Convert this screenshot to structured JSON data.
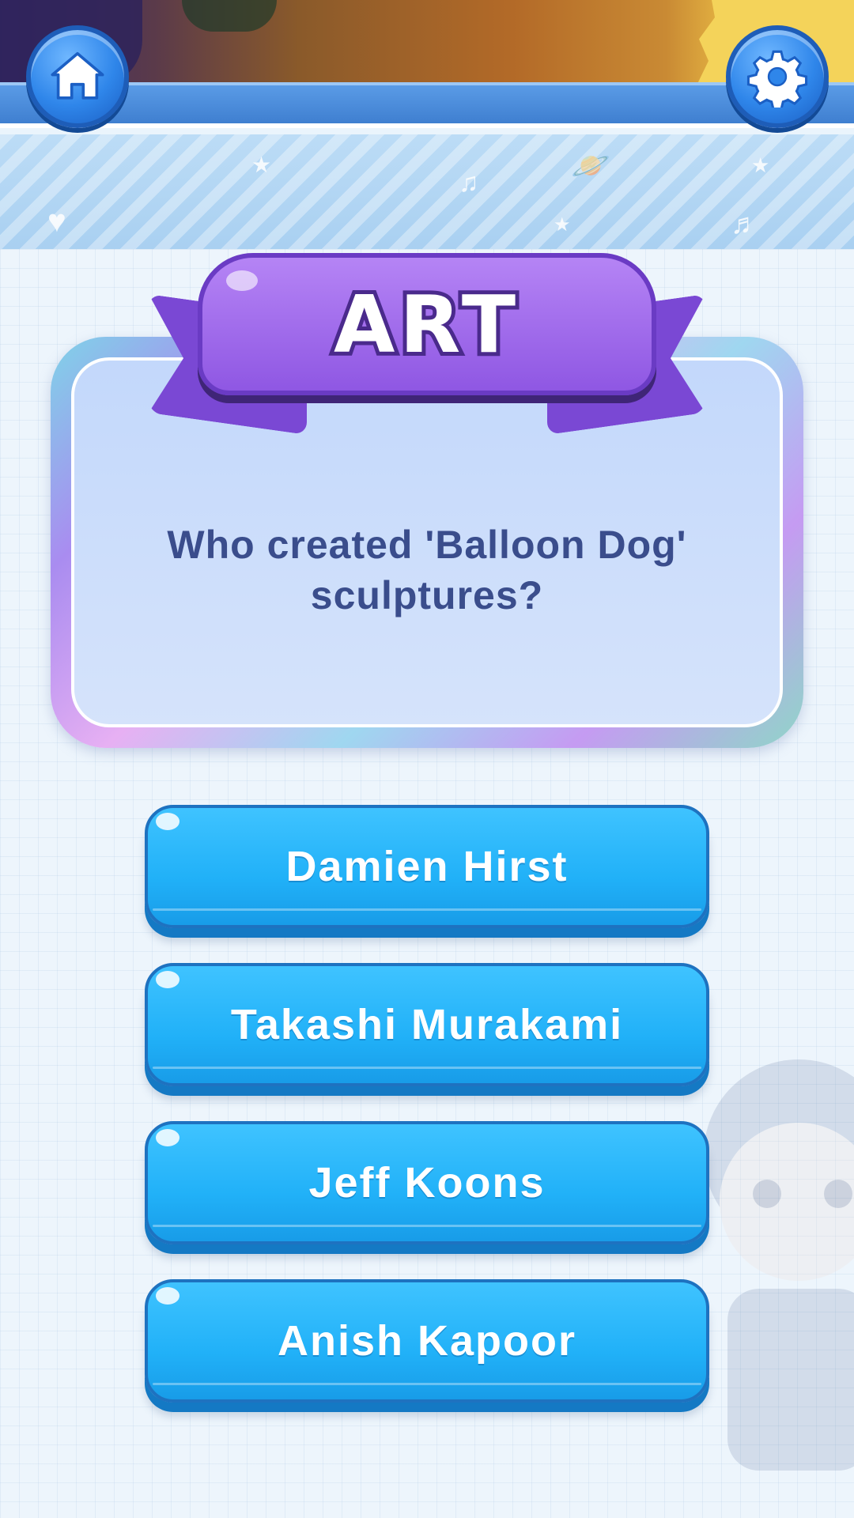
{
  "header": {
    "home_icon": "home-icon",
    "settings_icon": "gear-icon"
  },
  "category": {
    "label": "ART",
    "color": "#8f57e3"
  },
  "question": {
    "text": "Who created 'Balloon Dog' sculptures?"
  },
  "answers": [
    {
      "label": "Damien Hirst"
    },
    {
      "label": "Takashi Murakami"
    },
    {
      "label": "Jeff Koons"
    },
    {
      "label": "Anish Kapoor"
    }
  ],
  "colors": {
    "answer_button": "#21b1f8",
    "question_text": "#3a4d8c",
    "header_bar": "#3f7fd0"
  }
}
